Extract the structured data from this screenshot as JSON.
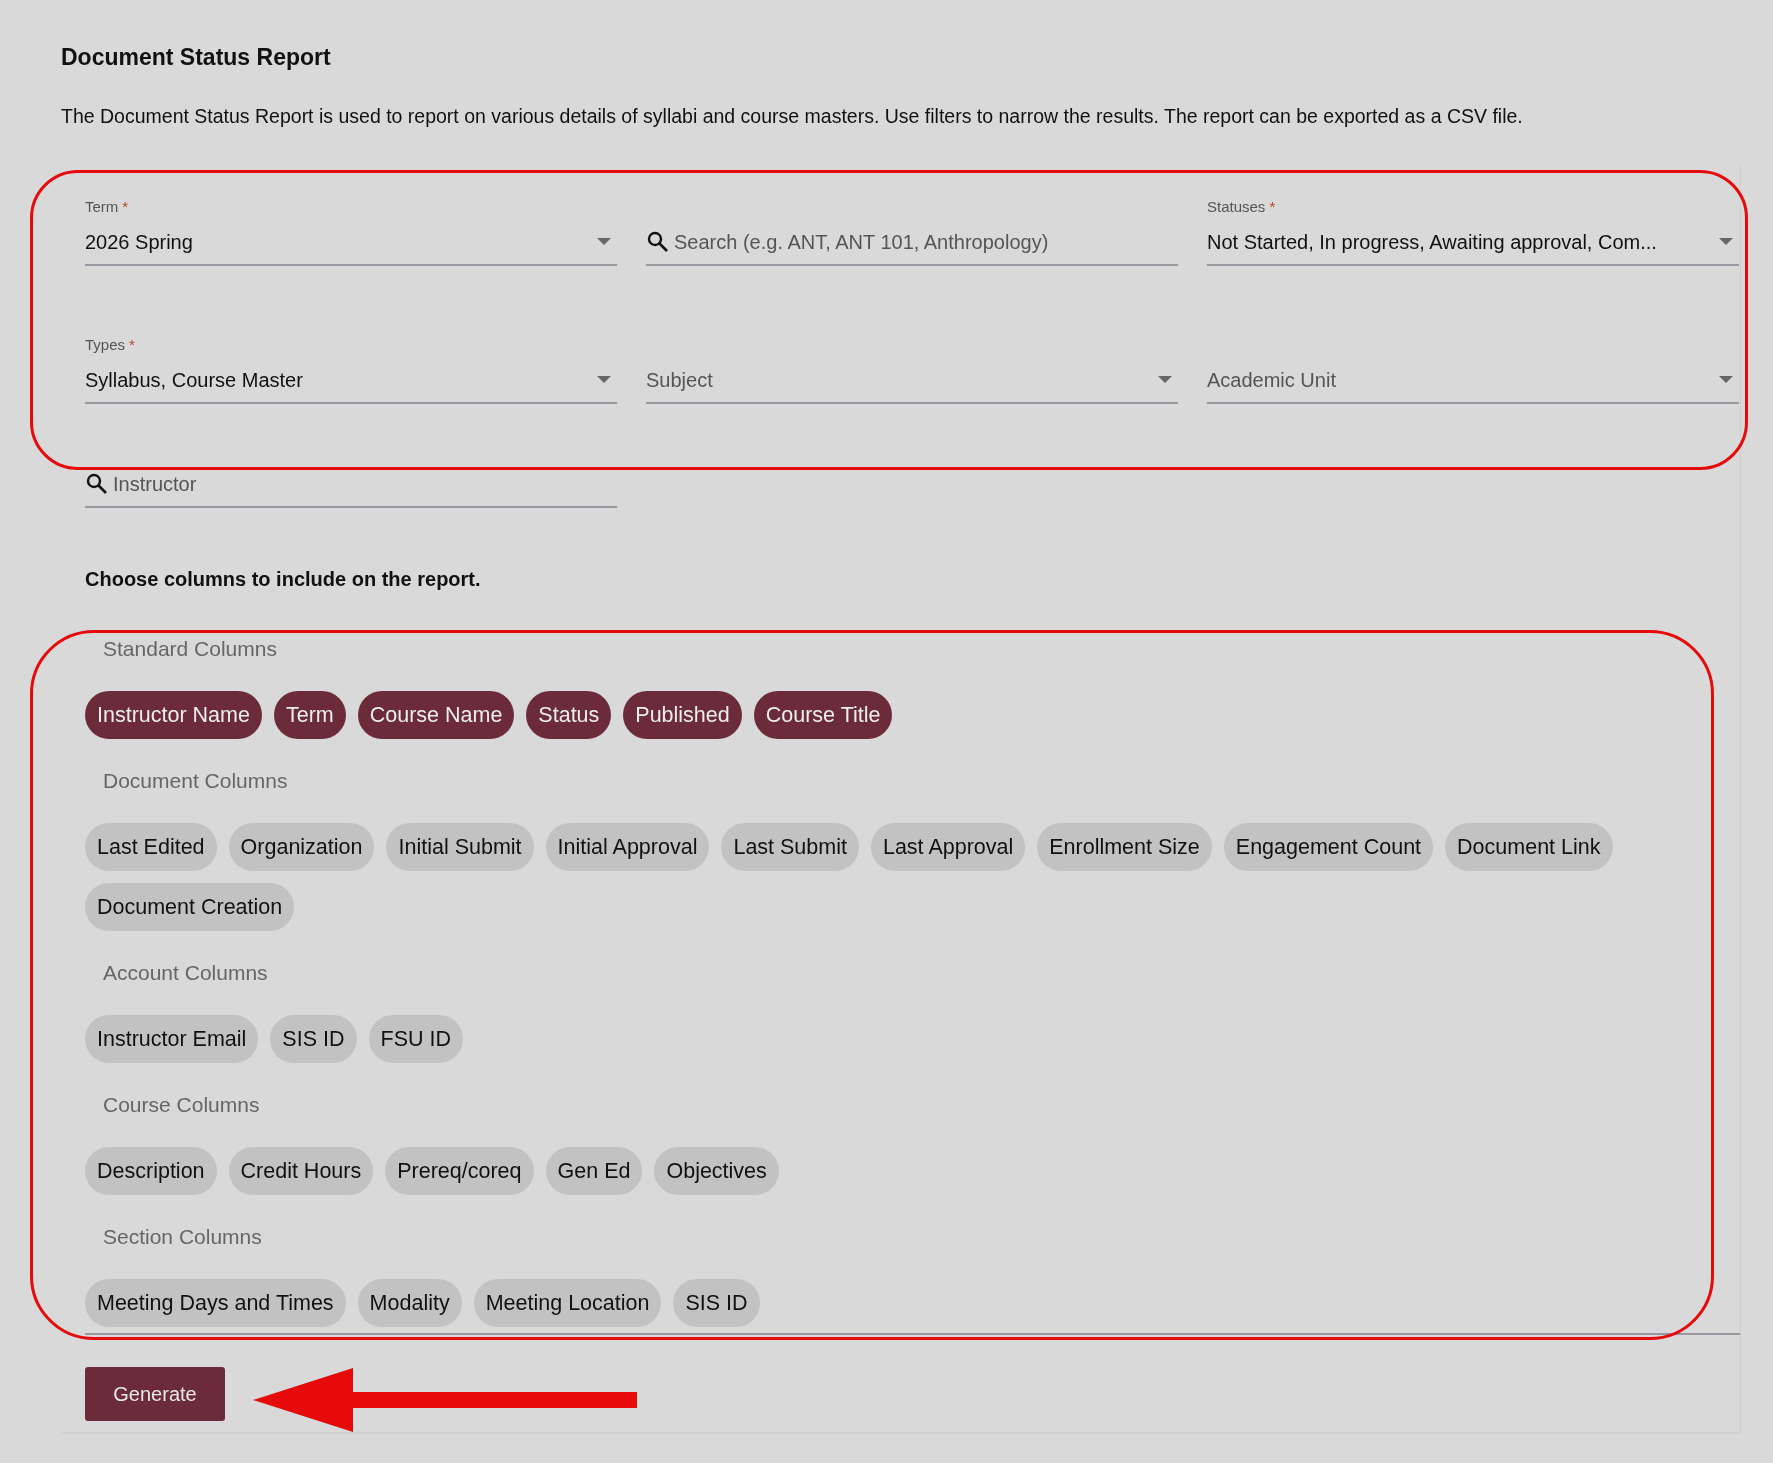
{
  "title": "Document Status Report",
  "description": "The Document Status Report is used to report on various details of syllabi and course masters. Use filters to narrow the results. The report can be exported as a CSV file.",
  "filters": [
    {
      "kind": "select",
      "label": "Term",
      "required_mark": "*",
      "value": "2026 Spring"
    },
    {
      "kind": "search",
      "placeholder": "Search (e.g. ANT, ANT 101, Anthropology)"
    },
    {
      "kind": "select",
      "label": "Statuses",
      "required_mark": "*",
      "value": "Not Started, In progress, Awaiting approval, Com..."
    },
    {
      "kind": "select",
      "label": "Types",
      "required_mark": "*",
      "value": "Syllabus, Course Master"
    },
    {
      "kind": "select",
      "placeholder": "Subject"
    },
    {
      "kind": "select",
      "placeholder": "Academic Unit"
    },
    {
      "kind": "search",
      "placeholder": "Instructor"
    }
  ],
  "columns_prompt": "Choose columns to include on the report.",
  "column_groups": [
    {
      "heading": "Standard Columns",
      "chips": [
        {
          "label": "Instructor Name",
          "selected": true
        },
        {
          "label": "Term",
          "selected": true
        },
        {
          "label": "Course Name",
          "selected": true
        },
        {
          "label": "Status",
          "selected": true
        },
        {
          "label": "Published",
          "selected": true
        },
        {
          "label": "Course Title",
          "selected": true
        }
      ]
    },
    {
      "heading": "Document Columns",
      "chips": [
        {
          "label": "Last Edited",
          "selected": false
        },
        {
          "label": "Organization",
          "selected": false
        },
        {
          "label": "Initial Submit",
          "selected": false
        },
        {
          "label": "Initial Approval",
          "selected": false
        },
        {
          "label": "Last Submit",
          "selected": false
        },
        {
          "label": "Last Approval",
          "selected": false
        },
        {
          "label": "Enrollment Size",
          "selected": false
        },
        {
          "label": "Engagement Count",
          "selected": false
        },
        {
          "label": "Document Link",
          "selected": false
        },
        {
          "label": "Document Creation",
          "selected": false
        }
      ]
    },
    {
      "heading": "Account Columns",
      "chips": [
        {
          "label": "Instructor Email",
          "selected": false
        },
        {
          "label": "SIS ID",
          "selected": false
        },
        {
          "label": "FSU ID",
          "selected": false
        }
      ]
    },
    {
      "heading": "Course Columns",
      "chips": [
        {
          "label": "Description",
          "selected": false
        },
        {
          "label": "Credit Hours",
          "selected": false
        },
        {
          "label": "Prereq/coreq",
          "selected": false
        },
        {
          "label": "Gen Ed",
          "selected": false
        },
        {
          "label": "Objectives",
          "selected": false
        }
      ]
    },
    {
      "heading": "Section Columns",
      "chips": [
        {
          "label": "Meeting Days and Times",
          "selected": false
        },
        {
          "label": "Modality",
          "selected": false
        },
        {
          "label": "Meeting Location",
          "selected": false
        },
        {
          "label": "SIS ID",
          "selected": false
        }
      ]
    }
  ],
  "generate_button": "Generate"
}
